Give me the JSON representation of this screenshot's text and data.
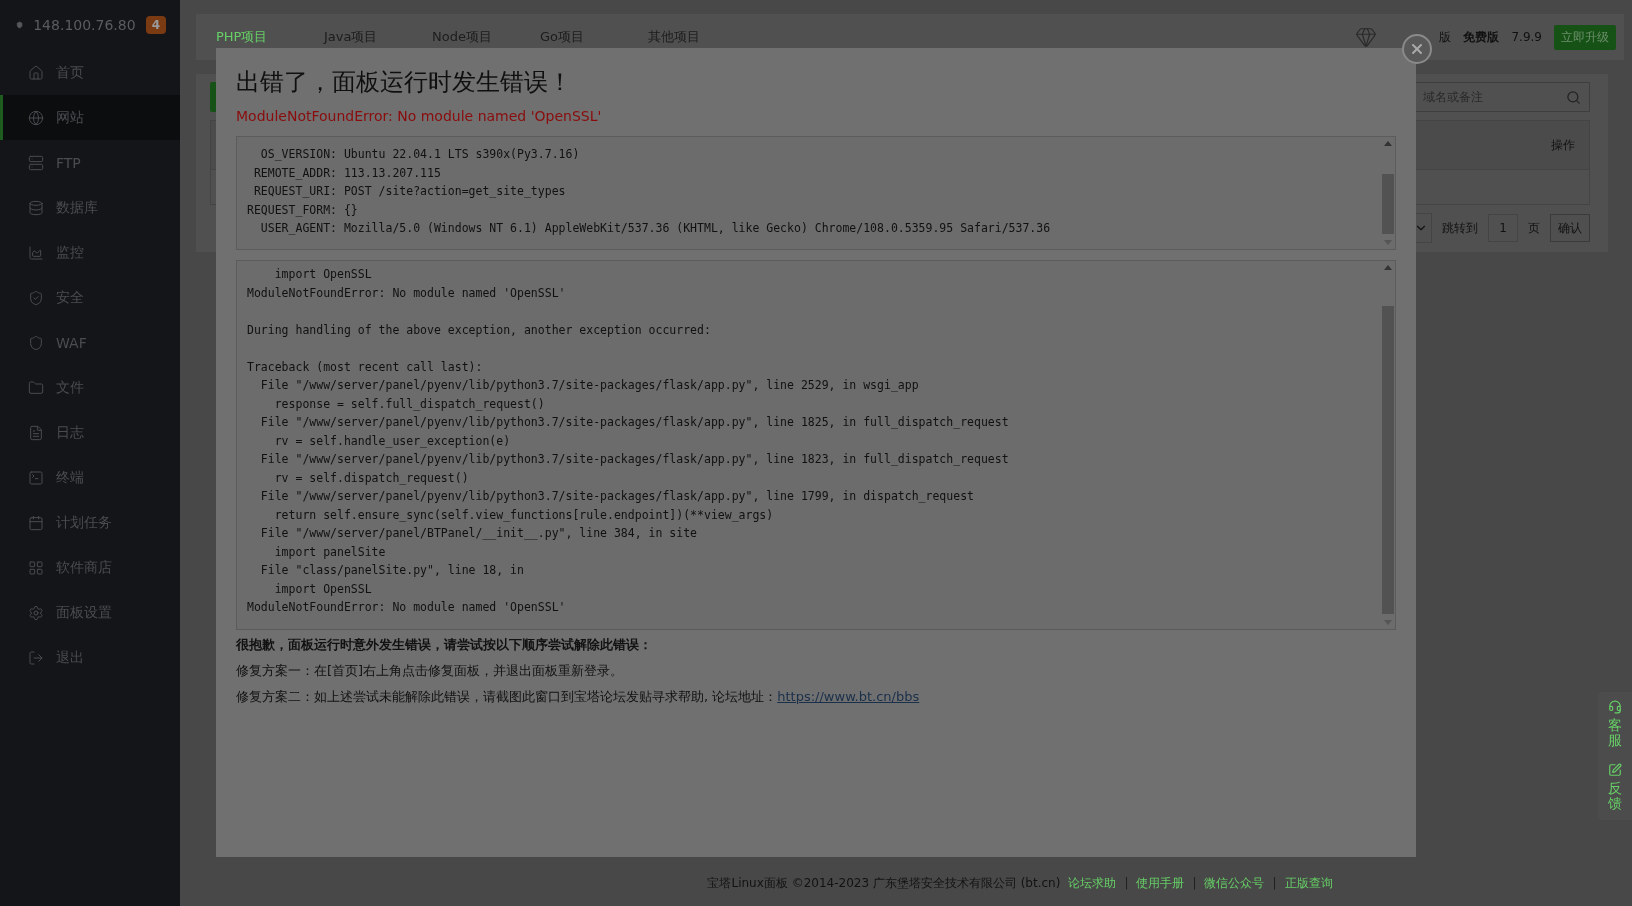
{
  "sidebar": {
    "host": "148.100.76.80",
    "badge": "4",
    "items": [
      {
        "label": "首页",
        "selected": false
      },
      {
        "label": "网站",
        "selected": true
      },
      {
        "label": "FTP",
        "selected": false
      },
      {
        "label": "数据库",
        "selected": false
      },
      {
        "label": "监控",
        "selected": false
      },
      {
        "label": "安全",
        "selected": false
      },
      {
        "label": "WAF",
        "selected": false
      },
      {
        "label": "文件",
        "selected": false
      },
      {
        "label": "日志",
        "selected": false
      },
      {
        "label": "终端",
        "selected": false
      },
      {
        "label": "计划任务",
        "selected": false
      },
      {
        "label": "软件商店",
        "selected": false
      },
      {
        "label": "面板设置",
        "selected": false
      },
      {
        "label": "退出",
        "selected": false
      }
    ]
  },
  "tabs": [
    {
      "label": "PHP项目",
      "selected": true
    },
    {
      "label": "Java项目",
      "selected": false
    },
    {
      "label": "Node项目",
      "selected": false
    },
    {
      "label": "Go项目",
      "selected": false
    },
    {
      "label": "其他项目",
      "selected": false
    }
  ],
  "topbar": {
    "edition_partial": "版",
    "edition": "免费版",
    "version": "7.9.9",
    "upgrade": "立即升级"
  },
  "search": {
    "placeholder": "域名或备注"
  },
  "table": {
    "columns": [
      "操作"
    ]
  },
  "pagination": {
    "jump_label": "跳转到",
    "page": "1",
    "page_unit": "页",
    "confirm": "确认"
  },
  "dialog": {
    "title": "出错了，面板运行时发生错误！",
    "error": "ModuleNotFoundError: No module named 'OpenSSL'",
    "env_lines": [
      "  OS_VERSION: Ubuntu 22.04.1 LTS s390x(Py3.7.16)",
      " REMOTE_ADDR: 113.13.207.115",
      " REQUEST_URI: POST /site?action=get_site_types",
      "REQUEST_FORM: {}",
      "  USER_AGENT: Mozilla/5.0 (Windows NT 6.1) AppleWebKit/537.36 (KHTML, like Gecko) Chrome/108.0.5359.95 Safari/537.36"
    ],
    "trace_groups": [
      [
        "    import OpenSSL",
        "ModuleNotFoundError: No module named 'OpenSSL'"
      ],
      [
        "During handling of the above exception, another exception occurred:"
      ],
      [
        "Traceback (most recent call last):",
        "  File \"/www/server/panel/pyenv/lib/python3.7/site-packages/flask/app.py\", line 2529, in wsgi_app",
        "    response = self.full_dispatch_request()",
        "  File \"/www/server/panel/pyenv/lib/python3.7/site-packages/flask/app.py\", line 1825, in full_dispatch_request",
        "    rv = self.handle_user_exception(e)",
        "  File \"/www/server/panel/pyenv/lib/python3.7/site-packages/flask/app.py\", line 1823, in full_dispatch_request",
        "    rv = self.dispatch_request()",
        "  File \"/www/server/panel/pyenv/lib/python3.7/site-packages/flask/app.py\", line 1799, in dispatch_request",
        "    return self.ensure_sync(self.view_functions[rule.endpoint])(**view_args)",
        "  File \"/www/server/panel/BTPanel/__init__.py\", line 384, in site",
        "    import panelSite",
        "  File \"class/panelSite.py\", line 18, in",
        "    import OpenSSL",
        "ModuleNotFoundError: No module named 'OpenSSL'"
      ]
    ],
    "help_title": "很抱歉，面板运行时意外发生错误，请尝试按以下顺序尝试解除此错误：",
    "fix_1": "修复方案一：在[首页]右上角点击修复面板，并退出面板重新登录。",
    "fix_2": "修复方案二：如上述尝试未能解除此错误，请截图此窗口到宝塔论坛发贴寻求帮助, 论坛地址：",
    "forum_link": "https://www.bt.cn/bbs"
  },
  "footer": {
    "copyright": "宝塔Linux面板 ©2014-2023 广东堡塔安全技术有限公司 (bt.cn)",
    "links": [
      "论坛求助",
      "使用手册",
      "微信公众号",
      "正版查询"
    ],
    "separator": "|"
  },
  "float_panel": [
    {
      "label": "客服"
    },
    {
      "label": "反馈"
    }
  ]
}
